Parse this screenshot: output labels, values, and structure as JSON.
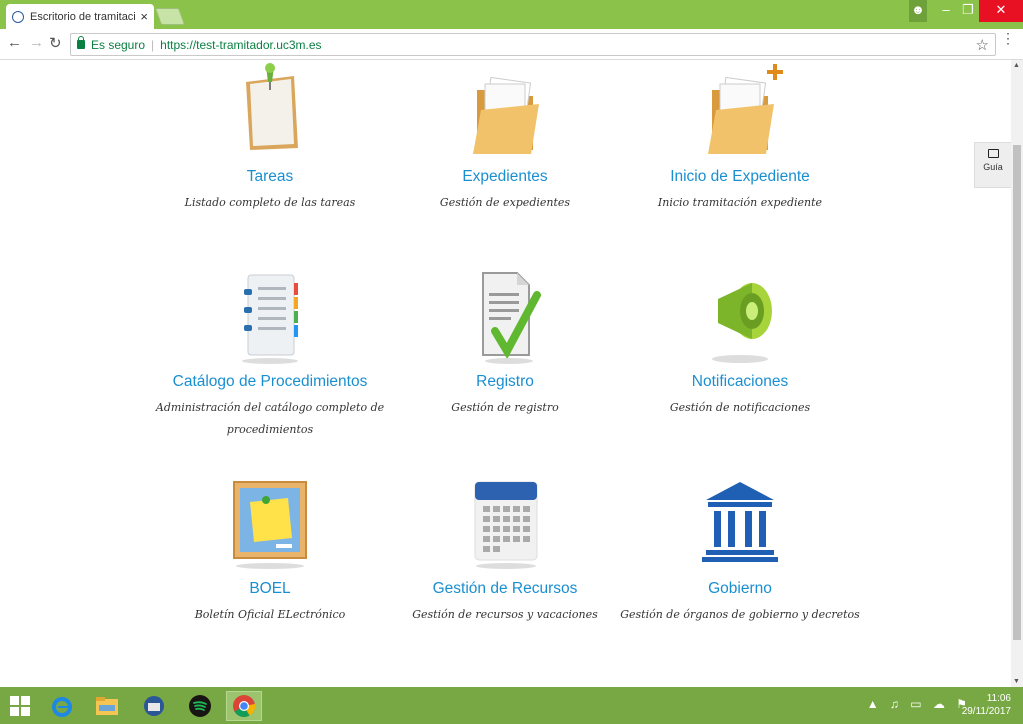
{
  "browser": {
    "tab_title": "Escritorio de tramitación",
    "secure_label": "Es seguro",
    "url": "https://test-tramitador.uc3m.es"
  },
  "side_button": {
    "label": "Guía"
  },
  "cards": [
    {
      "name": "Tareas",
      "desc": "Listado completo de las tareas",
      "icon": "pinned-note-icon"
    },
    {
      "name": "Expedientes",
      "desc": "Gestión de expedientes",
      "icon": "folder-icon"
    },
    {
      "name": "Inicio de Expediente",
      "desc": "Inicio tramitación expediente",
      "icon": "folder-add-icon"
    },
    {
      "name": "Catálogo de Procedimientos",
      "desc_line1": "Administración del catálogo completo de",
      "desc_line2": "procedimientos",
      "icon": "address-book-icon"
    },
    {
      "name": "Registro",
      "desc": "Gestión de registro",
      "icon": "document-check-icon"
    },
    {
      "name": "Notificaciones",
      "desc": "Gestión de notificaciones",
      "icon": "megaphone-icon"
    },
    {
      "name": "BOEL",
      "desc": "Boletín Oficial ELectrónico",
      "icon": "bulletin-board-icon"
    },
    {
      "name": "Gestión de Recursos",
      "desc": "Gestión de recursos y vacaciones",
      "icon": "calendar-icon"
    },
    {
      "name": "Gobierno",
      "desc": "Gestión de órganos de gobierno y decretos",
      "icon": "institution-icon"
    }
  ],
  "taskbar": {
    "time": "11:06",
    "date": "29/11/2017"
  },
  "colors": {
    "chrome_green": "#8bc34a",
    "link_blue": "#1a8fd0",
    "taskbar": "#78a843"
  }
}
